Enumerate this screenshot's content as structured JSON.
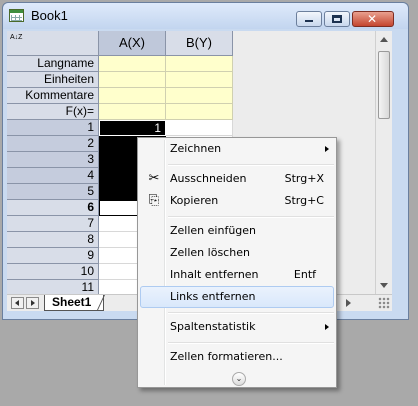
{
  "window": {
    "title": "Book1",
    "close_glyph": "✕"
  },
  "sheet": {
    "corner_icon": "A↓Z",
    "columns": [
      {
        "label": "A(X)"
      },
      {
        "label": "B(Y)"
      }
    ],
    "label_rows": [
      "Langname",
      "Einheiten",
      "Kommentare",
      "F(x)="
    ],
    "row_numbers": [
      "1",
      "2",
      "3",
      "4",
      "5",
      "6",
      "7",
      "8",
      "9",
      "10",
      "11"
    ],
    "cell_a1": "1",
    "selected_rows": [
      "1",
      "2",
      "3",
      "4",
      "5"
    ]
  },
  "tabs": {
    "active": "Sheet1"
  },
  "context_menu": {
    "items": [
      {
        "label": "Zeichnen",
        "shortcut": "",
        "submenu": true,
        "icon": ""
      },
      {
        "label": "Ausschneiden",
        "shortcut": "Strg+X",
        "submenu": false,
        "icon": "scissors-icon"
      },
      {
        "label": "Kopieren",
        "shortcut": "Strg+C",
        "submenu": false,
        "icon": "copy-icon"
      },
      {
        "label": "Zellen einfügen",
        "shortcut": "",
        "submenu": false,
        "icon": ""
      },
      {
        "label": "Zellen löschen",
        "shortcut": "",
        "submenu": false,
        "icon": ""
      },
      {
        "label": "Inhalt entfernen",
        "shortcut": "Entf",
        "submenu": false,
        "icon": ""
      },
      {
        "label": "Links entfernen",
        "shortcut": "",
        "submenu": false,
        "icon": "",
        "highlighted": true
      },
      {
        "label": "Spaltenstatistik",
        "shortcut": "",
        "submenu": true,
        "icon": ""
      },
      {
        "label": "Zellen formatieren...",
        "shortcut": "",
        "submenu": false,
        "icon": ""
      }
    ],
    "expand_glyph": "⌄"
  },
  "colors": {
    "selection": "#000000",
    "label_row_bg": "#ffffcc",
    "menu_highlight": "#d9e8fb",
    "close_button": "#c4452f"
  }
}
